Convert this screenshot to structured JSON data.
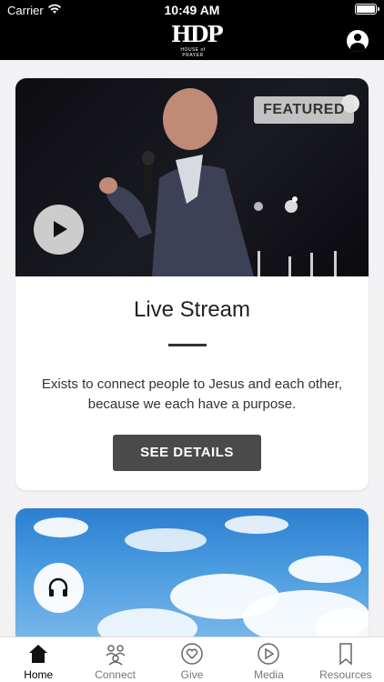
{
  "status_bar": {
    "carrier": "Carrier",
    "time": "10:49 AM"
  },
  "header": {
    "logo_mark": "HDP",
    "logo_text": "HOUSE of PRAYER"
  },
  "featured_card": {
    "badge": "FEATURED",
    "title": "Live Stream",
    "description": "Exists to connect people to Jesus and each other, because we each have a purpose.",
    "button_label": "SEE DETAILS"
  },
  "tabs": [
    {
      "label": "Home",
      "icon": "home-icon",
      "active": true
    },
    {
      "label": "Connect",
      "icon": "connect-icon",
      "active": false
    },
    {
      "label": "Give",
      "icon": "give-icon",
      "active": false
    },
    {
      "label": "Media",
      "icon": "media-icon",
      "active": false
    },
    {
      "label": "Resources",
      "icon": "resources-icon",
      "active": false
    }
  ],
  "colors": {
    "header_bg": "#000000",
    "button_bg": "#4a4a4a"
  }
}
